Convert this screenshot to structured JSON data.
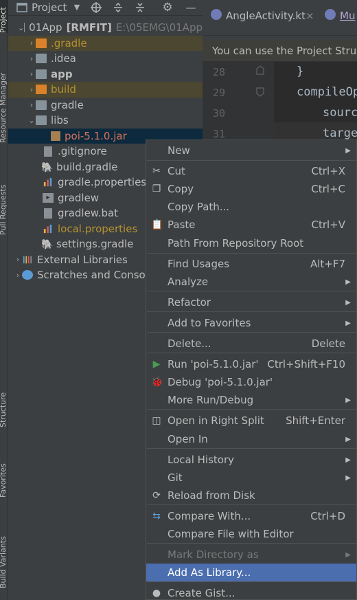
{
  "left_strip": {
    "tabs": [
      "Project",
      "Resource Manager",
      "Pull Requests",
      "Structure",
      "Favorites",
      "Build Variants"
    ]
  },
  "project_header": {
    "title": "Project",
    "dropdown_icon": "chevron-down-icon",
    "buttons": [
      "target-icon",
      "collapse-all-icon",
      "expand-all-icon",
      "gear-icon",
      "minimize-icon"
    ]
  },
  "tree": {
    "root_name": "01App",
    "root_module": "[RMFIT]",
    "root_path": "E:\\05EMG\\01App",
    "items": [
      {
        "label": ".gradle",
        "type": "folder-orange",
        "depth": 1,
        "collapsed": true
      },
      {
        "label": ".idea",
        "type": "folder",
        "depth": 1,
        "collapsed": true
      },
      {
        "label": "app",
        "type": "module",
        "depth": 1,
        "collapsed": true
      },
      {
        "label": "build",
        "type": "folder-orange",
        "depth": 1,
        "collapsed": true
      },
      {
        "label": "gradle",
        "type": "folder",
        "depth": 1,
        "collapsed": true
      },
      {
        "label": "libs",
        "type": "folder",
        "depth": 1,
        "expanded": true
      },
      {
        "label": "poi-5.1.0.jar",
        "type": "jar",
        "depth": 2
      },
      {
        "label": ".gitignore",
        "type": "file",
        "depth": 1
      },
      {
        "label": "build.gradle",
        "type": "gradle",
        "depth": 1
      },
      {
        "label": "gradle.properties",
        "type": "properties",
        "depth": 1
      },
      {
        "label": "gradlew",
        "type": "file",
        "depth": 1
      },
      {
        "label": "gradlew.bat",
        "type": "file",
        "depth": 1
      },
      {
        "label": "local.properties",
        "type": "properties",
        "depth": 1
      },
      {
        "label": "settings.gradle",
        "type": "gradle",
        "depth": 1
      }
    ],
    "external_libraries": "External Libraries",
    "scratches": "Scratches and Consoles"
  },
  "editor": {
    "tabs": [
      {
        "label": "AngleActivity.kt",
        "close": "×"
      },
      {
        "label": "Mu"
      }
    ],
    "banner": "You can use the Project Structure",
    "lines": [
      {
        "num": "28",
        "code": "}"
      },
      {
        "num": "29",
        "code": "compileOp"
      },
      {
        "num": "30",
        "code": "sourc"
      },
      {
        "num": "31",
        "code": "targe"
      }
    ]
  },
  "context_menu": {
    "items": [
      {
        "label": "New",
        "submenu": true
      },
      {
        "label": "Cut",
        "shortcut": "Ctrl+X",
        "icon": "scissors-icon"
      },
      {
        "label": "Copy",
        "shortcut": "Ctrl+C",
        "icon": "copy-icon"
      },
      {
        "label": "Copy Path..."
      },
      {
        "label": "Paste",
        "shortcut": "Ctrl+V",
        "icon": "paste-icon"
      },
      {
        "label": "Path From Repository Root"
      },
      {
        "label": "Find Usages",
        "shortcut": "Alt+F7"
      },
      {
        "label": "Analyze",
        "submenu": true
      },
      {
        "label": "Refactor",
        "submenu": true
      },
      {
        "label": "Add to Favorites",
        "submenu": true
      },
      {
        "label": "Delete...",
        "shortcut": "Delete"
      },
      {
        "label": "Run 'poi-5.1.0.jar'",
        "shortcut": "Ctrl+Shift+F10",
        "icon": "run-icon"
      },
      {
        "label": "Debug 'poi-5.1.0.jar'",
        "icon": "debug-icon"
      },
      {
        "label": "More Run/Debug",
        "submenu": true
      },
      {
        "label": "Open in Right Split",
        "shortcut": "Shift+Enter",
        "icon": "split-icon"
      },
      {
        "label": "Open In",
        "submenu": true
      },
      {
        "label": "Local History",
        "submenu": true
      },
      {
        "label": "Git",
        "submenu": true
      },
      {
        "label": "Reload from Disk",
        "icon": "reload-icon"
      },
      {
        "label": "Compare With...",
        "shortcut": "Ctrl+D",
        "icon": "compare-icon"
      },
      {
        "label": "Compare File with Editor"
      },
      {
        "label": "Mark Directory as",
        "submenu": true,
        "disabled": true
      },
      {
        "label": "Add As Library...",
        "active": true
      },
      {
        "label": "Create Gist...",
        "icon": "github-icon"
      }
    ]
  },
  "colors": {
    "accent": "#4b6eaf",
    "selected_row": "#0d293e",
    "excluded_highlight": "#4c4730",
    "jar_text": "#d9745a",
    "orange_folder_text": "#b39032",
    "local_props_text": "#b39032"
  }
}
